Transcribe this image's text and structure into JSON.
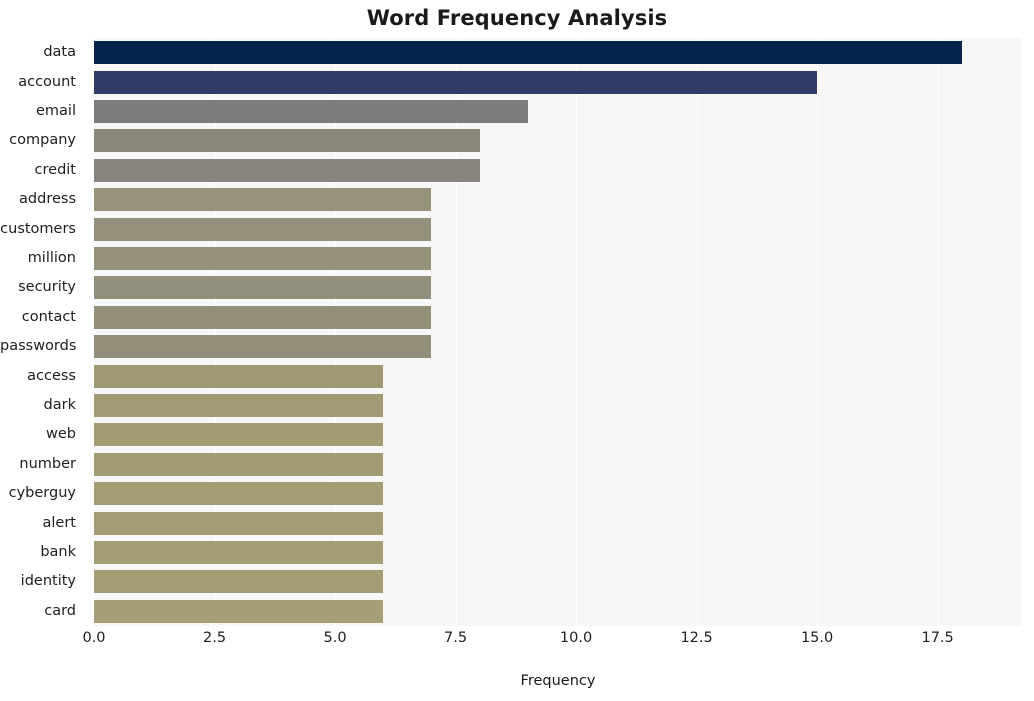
{
  "chart_data": {
    "type": "bar",
    "orientation": "horizontal",
    "title": "Word Frequency Analysis",
    "xlabel": "Frequency",
    "ylabel": "",
    "xlim": [
      0,
      19.25
    ],
    "ylim": [
      0,
      20
    ],
    "grid": true,
    "legend": null,
    "xticks": [
      "0.0",
      "2.5",
      "5.0",
      "7.5",
      "10.0",
      "12.5",
      "15.0",
      "17.5"
    ],
    "xtick_values": [
      0,
      2.5,
      5,
      7.5,
      10,
      12.5,
      15,
      17.5
    ],
    "categories": [
      "data",
      "account",
      "email",
      "company",
      "credit",
      "address",
      "customers",
      "million",
      "security",
      "contact",
      "passwords",
      "access",
      "dark",
      "web",
      "number",
      "cyberguy",
      "alert",
      "bank",
      "identity",
      "card"
    ],
    "values": [
      18,
      15,
      9,
      8,
      8,
      7,
      7,
      7,
      7,
      7,
      7,
      6,
      6,
      6,
      6,
      6,
      6,
      6,
      6,
      6
    ],
    "bar_colors": [
      "#04244c",
      "#303c66",
      "#7d7c7a",
      "#8a877a",
      "#86847c",
      "#97927a",
      "#94907b",
      "#969179",
      "#938f7d",
      "#949078",
      "#938e79",
      "#a09873",
      "#a29a74",
      "#a39b74",
      "#a39b74",
      "#a49c75",
      "#a49c75",
      "#a59d76",
      "#a59d76",
      "#a69e77"
    ]
  },
  "colors": {
    "figure_background": "#ffffff",
    "plot_background": "#f7f7f7",
    "gridline": "#ffffff",
    "title_text": "#1a1a1a",
    "tick_text": "#202020"
  }
}
